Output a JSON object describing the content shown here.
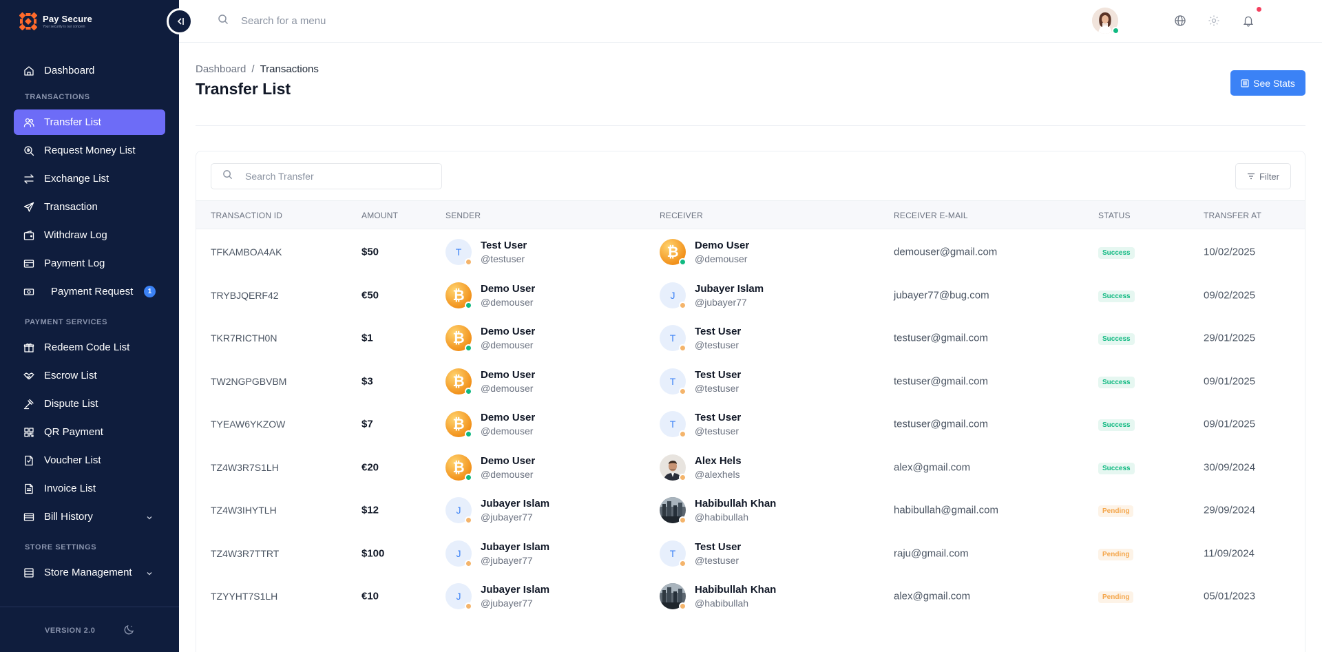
{
  "app": {
    "logo_title": "Pay Secure",
    "logo_subtitle": "Your security is our concern",
    "version": "VERSION 2.0"
  },
  "topbar": {
    "search_placeholder": "Search for a menu"
  },
  "sidebar": {
    "items": [
      {
        "label": "Dashboard",
        "icon": "home-icon"
      },
      {
        "section": "TRANSACTIONS"
      },
      {
        "label": "Transfer List",
        "icon": "users-icon",
        "active": true
      },
      {
        "label": "Request Money List",
        "icon": "search-money-icon"
      },
      {
        "label": "Exchange List",
        "icon": "exchange-icon"
      },
      {
        "label": "Transaction",
        "icon": "send-icon"
      },
      {
        "label": "Withdraw Log",
        "icon": "wallet-icon"
      },
      {
        "label": "Payment Log",
        "icon": "payment-icon"
      },
      {
        "label": "Payment Request",
        "icon": "money-icon",
        "badge": "1"
      },
      {
        "section": "PAYMENT SERVICES"
      },
      {
        "label": "Redeem Code List",
        "icon": "gift-icon"
      },
      {
        "label": "Escrow List",
        "icon": "handshake-icon"
      },
      {
        "label": "Dispute List",
        "icon": "gavel-icon"
      },
      {
        "label": "QR Payment",
        "icon": "qr-icon"
      },
      {
        "label": "Voucher List",
        "icon": "voucher-icon"
      },
      {
        "label": "Invoice List",
        "icon": "invoice-icon"
      },
      {
        "label": "Bill History",
        "icon": "bill-icon",
        "chevron": true
      },
      {
        "section": "STORE SETTINGS"
      },
      {
        "label": "Store Management",
        "icon": "store-icon",
        "chevron": true
      }
    ]
  },
  "page": {
    "breadcrumb": [
      "Dashboard",
      "/",
      "Transactions"
    ],
    "title": "Transfer List",
    "see_stats_label": "See Stats",
    "search_placeholder": "Search Transfer",
    "filter_label": "Filter"
  },
  "table": {
    "columns": [
      "TRANSACTION ID",
      "AMOUNT",
      "SENDER",
      "RECEIVER",
      "RECEIVER E-MAIL",
      "STATUS",
      "TRANSFER AT"
    ],
    "rows": [
      {
        "id": "TFKAMBOA4AK",
        "amount": "$50",
        "sender": {
          "name": "Test User",
          "handle": "@testuser",
          "avatar": "letter",
          "letter": "T",
          "status": "orange"
        },
        "receiver": {
          "name": "Demo User",
          "handle": "@demouser",
          "avatar": "bitcoin",
          "status": "green"
        },
        "email": "demouser@gmail.com",
        "status": "Success",
        "status_kind": "success",
        "date": "10/02/2025"
      },
      {
        "id": "TRYBJQERF42",
        "amount": "€50",
        "sender": {
          "name": "Demo User",
          "handle": "@demouser",
          "avatar": "bitcoin",
          "status": "green"
        },
        "receiver": {
          "name": "Jubayer Islam",
          "handle": "@jubayer77",
          "avatar": "letter",
          "letter": "J",
          "status": "orange"
        },
        "email": "jubayer77@bug.com",
        "status": "Success",
        "status_kind": "success",
        "date": "09/02/2025"
      },
      {
        "id": "TKR7RICTH0N",
        "amount": "$1",
        "sender": {
          "name": "Demo User",
          "handle": "@demouser",
          "avatar": "bitcoin",
          "status": "green"
        },
        "receiver": {
          "name": "Test User",
          "handle": "@testuser",
          "avatar": "letter",
          "letter": "T",
          "status": "orange"
        },
        "email": "testuser@gmail.com",
        "status": "Success",
        "status_kind": "success",
        "date": "29/01/2025"
      },
      {
        "id": "TW2NGPGBVBM",
        "amount": "$3",
        "sender": {
          "name": "Demo User",
          "handle": "@demouser",
          "avatar": "bitcoin",
          "status": "green"
        },
        "receiver": {
          "name": "Test User",
          "handle": "@testuser",
          "avatar": "letter",
          "letter": "T",
          "status": "orange"
        },
        "email": "testuser@gmail.com",
        "status": "Success",
        "status_kind": "success",
        "date": "09/01/2025"
      },
      {
        "id": "TYEAW6YKZOW",
        "amount": "$7",
        "sender": {
          "name": "Demo User",
          "handle": "@demouser",
          "avatar": "bitcoin",
          "status": "green"
        },
        "receiver": {
          "name": "Test User",
          "handle": "@testuser",
          "avatar": "letter",
          "letter": "T",
          "status": "orange"
        },
        "email": "testuser@gmail.com",
        "status": "Success",
        "status_kind": "success",
        "date": "09/01/2025"
      },
      {
        "id": "TZ4W3R7S1LH",
        "amount": "€20",
        "sender": {
          "name": "Demo User",
          "handle": "@demouser",
          "avatar": "bitcoin",
          "status": "green"
        },
        "receiver": {
          "name": "Alex Hels",
          "handle": "@alexhels",
          "avatar": "photo-man",
          "status": "orange"
        },
        "email": "alex@gmail.com",
        "status": "Success",
        "status_kind": "success",
        "date": "30/09/2024"
      },
      {
        "id": "TZ4W3IHYTLH",
        "amount": "$12",
        "sender": {
          "name": "Jubayer Islam",
          "handle": "@jubayer77",
          "avatar": "letter",
          "letter": "J",
          "status": "orange"
        },
        "receiver": {
          "name": "Habibullah Khan",
          "handle": "@habibullah",
          "avatar": "photo-city",
          "status": "orange"
        },
        "email": "habibullah@gmail.com",
        "status": "Pending",
        "status_kind": "pending",
        "date": "29/09/2024"
      },
      {
        "id": "TZ4W3R7TTRT",
        "amount": "$100",
        "sender": {
          "name": "Jubayer Islam",
          "handle": "@jubayer77",
          "avatar": "letter",
          "letter": "J",
          "status": "orange"
        },
        "receiver": {
          "name": "Test User",
          "handle": "@testuser",
          "avatar": "letter",
          "letter": "T",
          "status": "orange"
        },
        "email": "raju@gmail.com",
        "status": "Pending",
        "status_kind": "pending",
        "date": "11/09/2024"
      },
      {
        "id": "TZYYHT7S1LH",
        "amount": "€10",
        "sender": {
          "name": "Jubayer Islam",
          "handle": "@jubayer77",
          "avatar": "letter",
          "letter": "J",
          "status": "orange"
        },
        "receiver": {
          "name": "Habibullah Khan",
          "handle": "@habibullah",
          "avatar": "photo-city",
          "status": "orange"
        },
        "email": "alex@gmail.com",
        "status": "Pending",
        "status_kind": "pending",
        "date": "05/01/2023"
      }
    ]
  },
  "colors": {
    "sidebar_bg": "#0f1d3d",
    "active_item": "#6d6cf7",
    "primary": "#3b82f6",
    "success": "#10b981",
    "pending": "#f4a64b",
    "bitcoin": "#f7931a"
  }
}
